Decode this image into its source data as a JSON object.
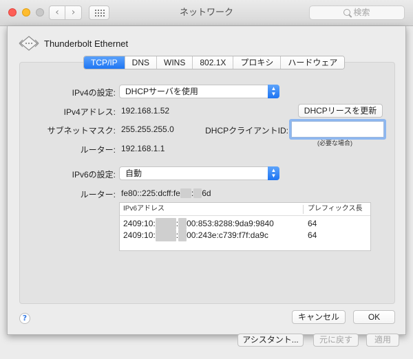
{
  "window": {
    "title": "ネットワーク",
    "search_placeholder": "検索"
  },
  "interface": {
    "name": "Thunderbolt Ethernet"
  },
  "tabs": [
    {
      "label": "TCP/IP",
      "active": true
    },
    {
      "label": "DNS",
      "active": false
    },
    {
      "label": "WINS",
      "active": false
    },
    {
      "label": "802.1X",
      "active": false
    },
    {
      "label": "プロキシ",
      "active": false
    },
    {
      "label": "ハードウェア",
      "active": false
    }
  ],
  "ipv4": {
    "config_label": "IPv4の設定:",
    "config_value": "DHCPサーバを使用",
    "address_label": "IPv4アドレス:",
    "address_value": "192.168.1.52",
    "subnet_label": "サブネットマスク:",
    "subnet_value": "255.255.255.0",
    "router_label": "ルーター:",
    "router_value": "192.168.1.1",
    "renew_button": "DHCPリースを更新",
    "client_id_label": "DHCPクライアントID:",
    "client_id_value": "",
    "client_id_hint": "(必要な場合)"
  },
  "ipv6": {
    "config_label": "IPv6の設定:",
    "config_value": "自動",
    "router_label": "ルーター:",
    "router_prefix": "fe80::225:dcff:fe",
    "router_sep": ":",
    "router_suffix": "6d",
    "table": {
      "col_address": "IPv6アドレス",
      "col_prefix": "プレフィックス長",
      "rows": [
        {
          "addr_prefix": "2409:10:",
          "addr_sep": ":",
          "addr_suffix": "00:853:8288:9da9:9840",
          "prefix_len": "64"
        },
        {
          "addr_prefix": "2409:10:",
          "addr_sep": ":",
          "addr_suffix": "00:243e:c739:f7f:da9c",
          "prefix_len": "64"
        }
      ]
    }
  },
  "buttons": {
    "help": "?",
    "cancel": "キャンセル",
    "ok": "OK",
    "assistant": "アシスタント...",
    "revert": "元に戻す",
    "apply": "適用"
  },
  "colors": {
    "accent": "#1f76f3",
    "close": "#fd5f57",
    "minimize": "#febc2e",
    "zoom": "#c8c8c8"
  }
}
